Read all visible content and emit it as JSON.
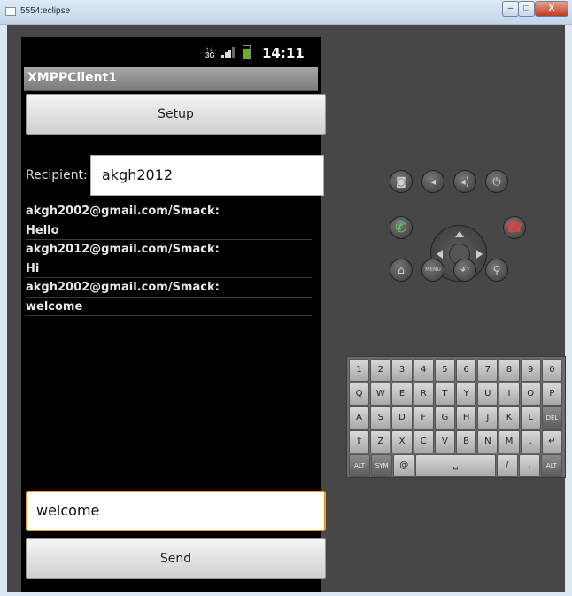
{
  "window": {
    "title": "5554:eclipse",
    "close_label": "X"
  },
  "status": {
    "network": "3G",
    "time": "14:11"
  },
  "app": {
    "title": "XMPPClient1",
    "setup_label": "Setup",
    "recipient_label": "Recipient:",
    "recipient_value": "akgh2012",
    "messages": [
      "akgh2002@gmail.com/Smack:",
      "Hello",
      "akgh2012@gmail.com/Smack:",
      "Hi",
      "akgh2002@gmail.com/Smack:",
      "welcome"
    ],
    "message_input_value": "welcome",
    "send_label": "Send"
  },
  "hardware": {
    "buttons": [
      "camera",
      "volume-down",
      "volume-up",
      "power",
      "call",
      "hang-up",
      "home",
      "menu",
      "back",
      "search"
    ],
    "menu_label": "MENU"
  },
  "keyboard": {
    "rows": [
      [
        "1",
        "2",
        "3",
        "4",
        "5",
        "6",
        "7",
        "8",
        "9",
        "0"
      ],
      [
        "Q",
        "W",
        "E",
        "R",
        "T",
        "Y",
        "U",
        "I",
        "O",
        "P"
      ],
      [
        "A",
        "S",
        "D",
        "F",
        "G",
        "H",
        "J",
        "K",
        "L",
        "DEL"
      ],
      [
        "⇧",
        "Z",
        "X",
        "C",
        "V",
        "B",
        "N",
        "M",
        ".",
        "↵"
      ],
      [
        "ALT",
        "SYM",
        "@",
        "␣",
        "/",
        ",",
        "ALT"
      ]
    ]
  }
}
